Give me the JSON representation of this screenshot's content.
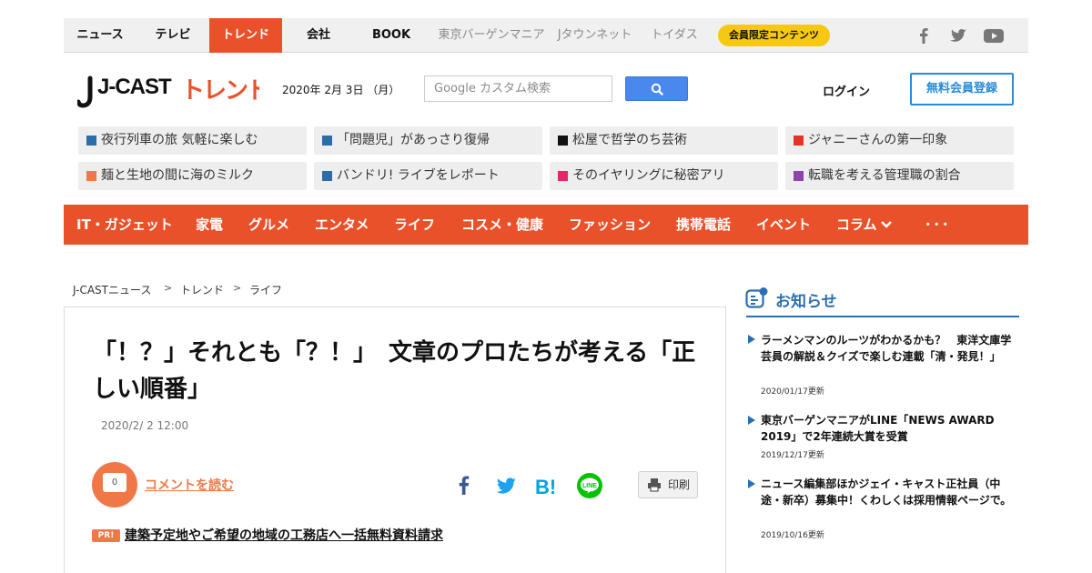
{
  "top_nav": {
    "items": [
      "ニュース",
      "テレビ",
      "トレンド",
      "会社",
      "BOOK",
      "東京バーゲンマニア",
      "Jタウンネット",
      "トイダス"
    ],
    "member_pill": "会員限定コンテンツ",
    "social": [
      "facebook-icon",
      "twitter-icon",
      "youtube-icon"
    ]
  },
  "header": {
    "logo_main": "J-CAST",
    "logo_sub": "トレンド",
    "date": "2020年 2月 3日 （月）",
    "search_placeholder": "Google カスタム検索",
    "login": "ログイン",
    "register": "無料会員登録"
  },
  "topics": [
    {
      "label": "夜行列車の旅 気軽に楽しむ",
      "color": "#2a6da8"
    },
    {
      "label": "「問題児」があっさり復帰",
      "color": "#2a6da8"
    },
    {
      "label": "松屋で哲学のち芸術",
      "color": "#111111"
    },
    {
      "label": "ジャニーさんの第一印象",
      "color": "#e3342a"
    },
    {
      "label": "麺と生地の間に海のミルク",
      "color": "#f07848"
    },
    {
      "label": "バンドリ! ライブをレポート",
      "color": "#2a6da8"
    },
    {
      "label": "そのイヤリングに秘密アリ",
      "color": "#e8256a"
    },
    {
      "label": "転職を考える管理職の割合",
      "color": "#8e44ad"
    }
  ],
  "categories": [
    "IT・ガジェット",
    "家電",
    "グルメ",
    "エンタメ",
    "ライフ",
    "コスメ・健康",
    "ファッション",
    "携帯電話",
    "イベント",
    "コラム",
    "･･･"
  ],
  "breadcrumb": [
    "J-CASTニュース",
    "トレンド",
    "ライフ"
  ],
  "article": {
    "title": "「！？」それとも「？！」　文章のプロたちが考える「正しい順番」",
    "date": "2020/2/ 2 12:00",
    "comment_count": "0",
    "comment_link": "コメントを読む",
    "print": "印刷",
    "pr_badge": "PR!",
    "pr_text": "建築予定地やご希望の地域の工務店へ一括無料資料請求"
  },
  "notices": {
    "title": "お知らせ",
    "items": [
      {
        "text": "ラーメンマンのルーツがわかるかも？　東洋文庫学芸員の解説＆クイズで楽しむ連載「清・発見！」",
        "date": "2020/01/17更新"
      },
      {
        "text": "東京バーゲンマニアがLINE「NEWS AWARD 2019」で2年連続大賞を受賞",
        "date": "2019/12/17更新"
      },
      {
        "text": "ニュース編集部ほかジェイ・キャスト正社員（中途・新卒）募集中！くわしくは採用情報ページで。",
        "date": "2019/10/16更新"
      }
    ]
  },
  "colors": {
    "accent": "#e9512b",
    "blue": "#2c6fb0",
    "search": "#4b88ee",
    "pill": "#f7c811"
  }
}
